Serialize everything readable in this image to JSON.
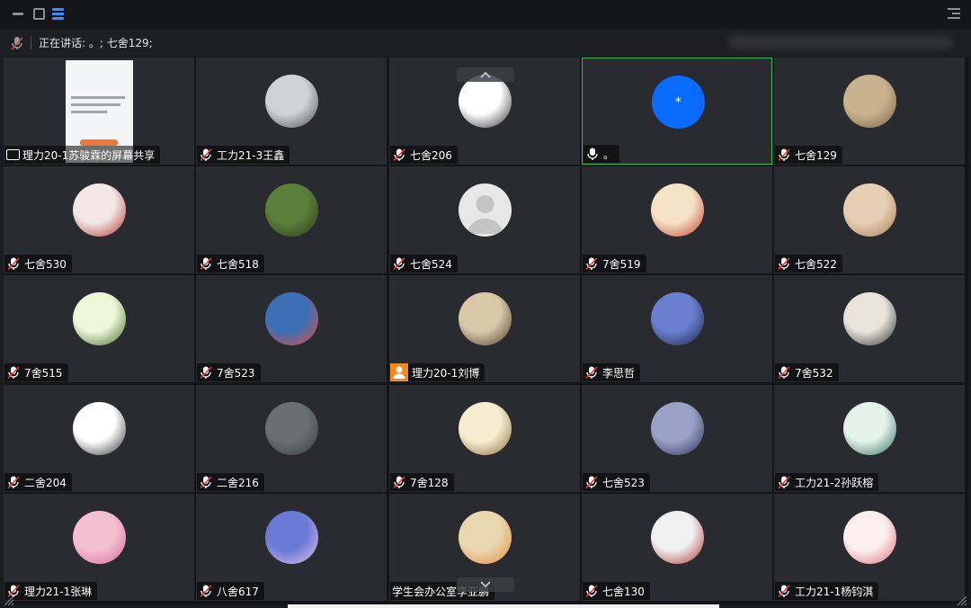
{
  "toolbar": {
    "minimize_icon": "minimize-icon",
    "maximize_icon": "maximize-icon",
    "list_icon": "list-layout-icon",
    "menu_icon": "menu-icon"
  },
  "speaking": {
    "label": "正在讲话: 。; 七舍129;"
  },
  "tiles": [
    {
      "name": "理力20-1苏骏霖的屏幕共享",
      "type": "screen-share",
      "avatar": "doc"
    },
    {
      "name": "工力21-3王鑫",
      "type": "muted",
      "avatar": "photo-gray"
    },
    {
      "name": "七舍206",
      "type": "muted",
      "avatar": "panda"
    },
    {
      "name": "。",
      "type": "mic-on",
      "avatar": "letter",
      "letter": "*",
      "selected": true
    },
    {
      "name": "七舍129",
      "type": "muted",
      "avatar": "dog"
    },
    {
      "name": "七舍530",
      "type": "muted",
      "avatar": "anime-red"
    },
    {
      "name": "七舍518",
      "type": "muted",
      "avatar": "meme"
    },
    {
      "name": "七舍524",
      "type": "muted",
      "avatar": "default"
    },
    {
      "name": "7舍519",
      "type": "muted",
      "avatar": "shinchan"
    },
    {
      "name": "七舍522",
      "type": "muted",
      "avatar": "child"
    },
    {
      "name": "7舍515",
      "type": "muted",
      "avatar": "panda-green"
    },
    {
      "name": "7舍523",
      "type": "muted",
      "avatar": "masked"
    },
    {
      "name": "理力20-1刘博",
      "type": "host",
      "avatar": "boy"
    },
    {
      "name": "李思哲",
      "type": "muted",
      "avatar": "anime-blue"
    },
    {
      "name": "7舍532",
      "type": "muted",
      "avatar": "bird"
    },
    {
      "name": "二舍204",
      "type": "muted",
      "avatar": "panda"
    },
    {
      "name": "二舍216",
      "type": "muted",
      "avatar": "water"
    },
    {
      "name": "7舍128",
      "type": "muted",
      "avatar": "anime-blond"
    },
    {
      "name": "七舍523",
      "type": "muted",
      "avatar": "anime-dark"
    },
    {
      "name": "工力21-2孙跃榕",
      "type": "muted",
      "avatar": "anime-green"
    },
    {
      "name": "理力21-1张琳",
      "type": "muted",
      "avatar": "cat-pink"
    },
    {
      "name": "八舍617",
      "type": "muted",
      "avatar": "anime-purple"
    },
    {
      "name": "学生会办公室李亚鹏",
      "type": "none",
      "avatar": "anime-orange"
    },
    {
      "name": "七舍130",
      "type": "muted",
      "avatar": "anime-red2"
    },
    {
      "name": "工力21-1杨钧淇",
      "type": "muted",
      "avatar": "anime-girl"
    }
  ],
  "colors": {
    "background": "#1b1c1f",
    "tile": "#2a2b30",
    "selected_border": "#3dbb55",
    "accent": "#0a6cff",
    "muted_mic": "#e23b3b",
    "host_badge": "#f08a24"
  }
}
